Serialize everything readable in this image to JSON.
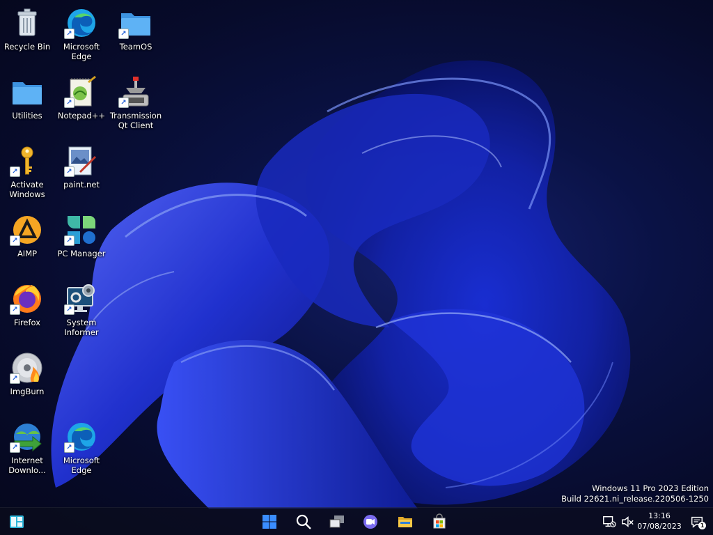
{
  "desktop": {
    "icons": [
      {
        "label": "Recycle Bin",
        "icon": "recycle-bin-icon"
      },
      {
        "label": "Microsoft\nEdge",
        "icon": "edge-icon"
      },
      {
        "label": "TeamOS",
        "icon": "folder-icon"
      },
      {
        "label": "Utilities",
        "icon": "folder-icon"
      },
      {
        "label": "Notepad++",
        "icon": "notepadpp-icon"
      },
      {
        "label": "Transmission\nQt Client",
        "icon": "transmission-icon"
      },
      {
        "label": "Activate\nWindows",
        "icon": "key-icon"
      },
      {
        "label": "paint.net",
        "icon": "paintnet-icon"
      },
      {
        "label": "AIMP",
        "icon": "aimp-icon"
      },
      {
        "label": "PC Manager",
        "icon": "pc-manager-icon"
      },
      {
        "label": "Firefox",
        "icon": "firefox-icon"
      },
      {
        "label": "System\nInformer",
        "icon": "system-informer-icon"
      },
      {
        "label": "ImgBurn",
        "icon": "imgburn-icon"
      },
      {
        "label": "Internet\nDownlo...",
        "icon": "idm-icon"
      },
      {
        "label": "Microsoft\nEdge",
        "icon": "edge-icon"
      }
    ]
  },
  "watermark": {
    "line1": "Windows 11 Pro 2023 Edition",
    "line2": "Build 22621.ni_release.220506-1250"
  },
  "taskbar": {
    "items": [
      "widgets-icon",
      "start-icon",
      "search-icon",
      "task-view-icon",
      "chat-icon",
      "file-explorer-icon",
      "store-icon"
    ],
    "tray": [
      "network-icon",
      "volume-muted-icon",
      "notification-icon"
    ],
    "time": "13:16",
    "date": "07/08/2023",
    "notification_count": "1"
  },
  "colors": {
    "accent": "#2f8cff",
    "folder": "#4aa3f0",
    "taskbar": "#0c0e1c"
  }
}
